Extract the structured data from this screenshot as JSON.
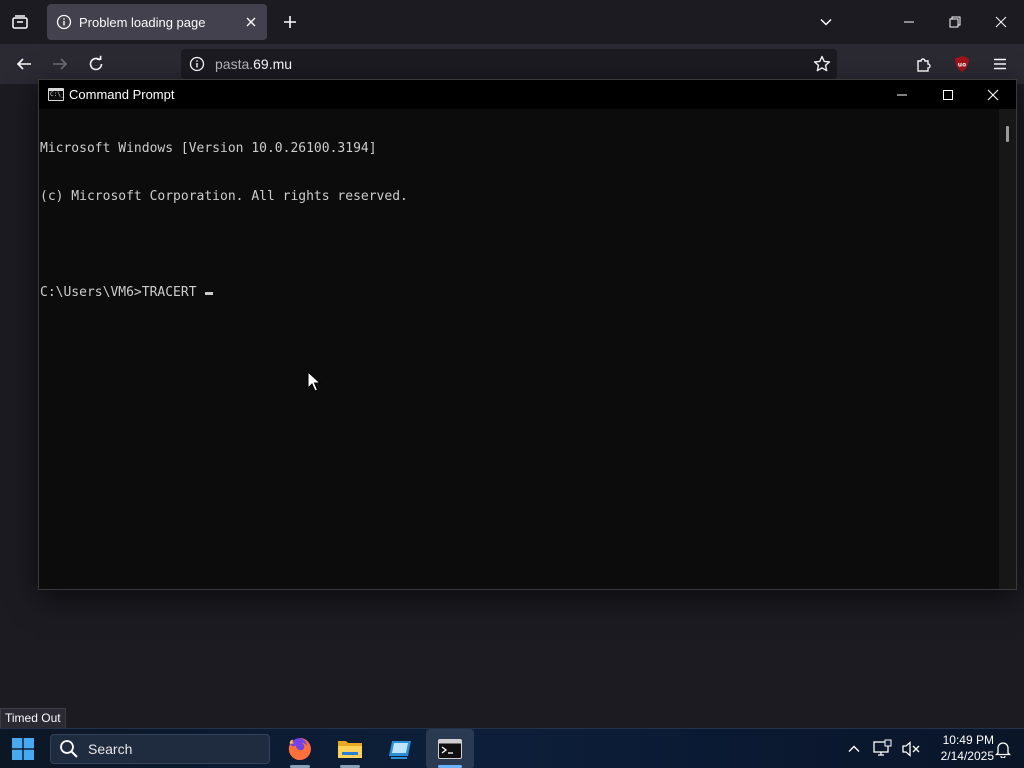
{
  "browser": {
    "tab": {
      "title": "Problem loading page"
    },
    "url": {
      "prefix": "pasta.",
      "domain": "69.mu"
    },
    "status_text": "Timed Out"
  },
  "cmd": {
    "title": "Command Prompt",
    "icon_text": "C:\\_",
    "lines": [
      "Microsoft Windows [Version 10.0.26100.3194]",
      "(c) Microsoft Corporation. All rights reserved.",
      "",
      "C:\\Users\\VM6>TRACERT "
    ]
  },
  "taskbar": {
    "search_label": "Search",
    "apps": [
      "firefox-icon",
      "file-explorer-icon",
      "remote-desktop-icon",
      "command-prompt-icon"
    ],
    "clock": {
      "time": "10:49 PM",
      "date": "2/14/2025"
    }
  },
  "colors": {
    "browser_bg": "#1c1b22",
    "toolbar_bg": "#2b2a33",
    "cmd_bg": "#0c0c0c",
    "cmd_text": "#cccccc",
    "ublock_red": "#a2141c"
  }
}
